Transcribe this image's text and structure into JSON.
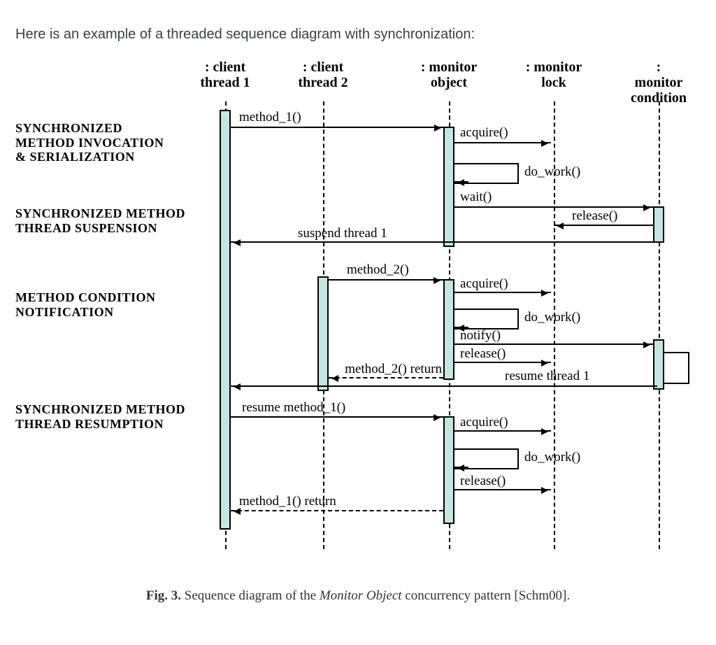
{
  "intro": "Here is an example of a threaded sequence diagram with synchronization:",
  "lanes": {
    "t1": {
      "top": ": client",
      "bot": "thread 1"
    },
    "t2": {
      "top": ": client",
      "bot": "thread 2"
    },
    "obj": {
      "top": ": monitor",
      "bot": "object"
    },
    "lk": {
      "top": ": monitor",
      "bot": "lock"
    },
    "cnd": {
      "top": ": monitor",
      "bot": "condition"
    }
  },
  "phases": {
    "p1a": "SYNCHRONIZED",
    "p1b": "METHOD INVOCATION",
    "p1c": "& SERIALIZATION",
    "p2a": "SYNCHRONIZED METHOD",
    "p2b": "THREAD SUSPENSION",
    "p3a": "METHOD CONDITION",
    "p3b": "NOTIFICATION",
    "p4a": "SYNCHRONIZED METHOD",
    "p4b": "THREAD RESUMPTION"
  },
  "m": {
    "method1": "method_1()",
    "acquire1": "acquire()",
    "dowork1": "do_work()",
    "wait": "wait()",
    "release1": "release()",
    "suspend": "suspend thread 1",
    "method2": "method_2()",
    "acquire2": "acquire()",
    "dowork2": "do_work()",
    "notify": "notify()",
    "release2": "release()",
    "method2ret": "method_2() return",
    "resumet1": "resume thread 1",
    "resume_m1": "resume method_1()",
    "acquire3": "acquire()",
    "dowork3": "do_work()",
    "release3": "release()",
    "method1ret": "method_1() return"
  },
  "caption": {
    "lead": "Fig. 3.",
    "mid": " Sequence diagram of the ",
    "ital": "Monitor Object",
    "tail": " concurrency pattern [Schm00]."
  }
}
